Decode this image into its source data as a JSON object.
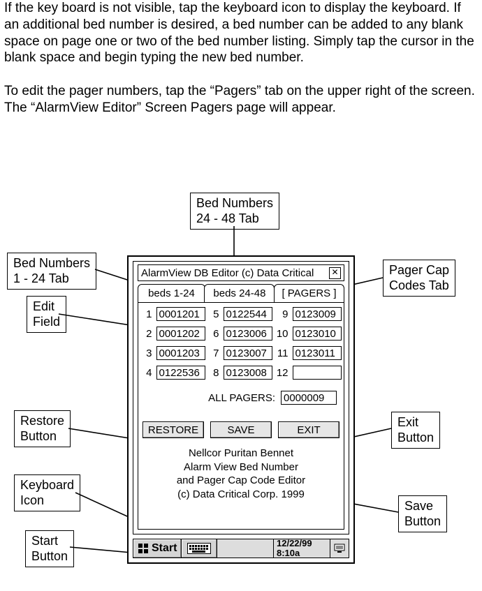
{
  "intro": {
    "p1": "If the key board is not visible, tap the keyboard icon to display the keyboard.  If an additional bed number is desired, a bed number can be added to any blank space on page one or two of the bed number listing.  Simply tap the cursor in the blank space and begin typing the new bed number.",
    "p2": "To edit the pager numbers, tap the “Pagers” tab on the upper right of the screen.  The “AlarmView Editor” Screen Pagers page will appear."
  },
  "callouts": {
    "beds_24_48_tab": "Bed Numbers\n24 - 48 Tab",
    "beds_1_24_tab": "Bed Numbers\n1 - 24 Tab",
    "edit_field": "Edit\nField",
    "pager_cap_codes_tab": "Pager Cap\nCodes Tab",
    "restore_button": "Restore\nButton",
    "keyboard_icon": "Keyboard\nIcon",
    "start_button": "Start\nButton",
    "exit_button": "Exit\nButton",
    "save_button": "Save\nButton"
  },
  "pda": {
    "title": "AlarmView DB Editor (c) Data Critical",
    "tabs": {
      "beds_1_24": "beds 1-24",
      "beds_24_48": "beds 24-48",
      "pagers": "[ PAGERS ]"
    },
    "pagers": [
      {
        "n": "1",
        "v": "0001201"
      },
      {
        "n": "2",
        "v": "0001202"
      },
      {
        "n": "3",
        "v": "0001203"
      },
      {
        "n": "4",
        "v": "0122536"
      },
      {
        "n": "5",
        "v": "0122544"
      },
      {
        "n": "6",
        "v": "0123006"
      },
      {
        "n": "7",
        "v": "0123007"
      },
      {
        "n": "8",
        "v": "0123008"
      },
      {
        "n": "9",
        "v": "0123009"
      },
      {
        "n": "10",
        "v": "0123010"
      },
      {
        "n": "11",
        "v": "0123011"
      },
      {
        "n": "12",
        "v": ""
      }
    ],
    "all_pagers_label": "ALL PAGERS:",
    "all_pagers_value": "0000009",
    "buttons": {
      "restore": "RESTORE",
      "save": "SAVE",
      "exit": "EXIT"
    },
    "footer": {
      "l1": "Nellcor Puritan Bennet",
      "l2": "Alarm View Bed Number",
      "l3": "and  Pager Cap Code Editor",
      "l4": "(c) Data Critical Corp. 1999"
    },
    "taskbar": {
      "start": "Start",
      "date": "12/22/99",
      "time": "8:10a"
    }
  }
}
